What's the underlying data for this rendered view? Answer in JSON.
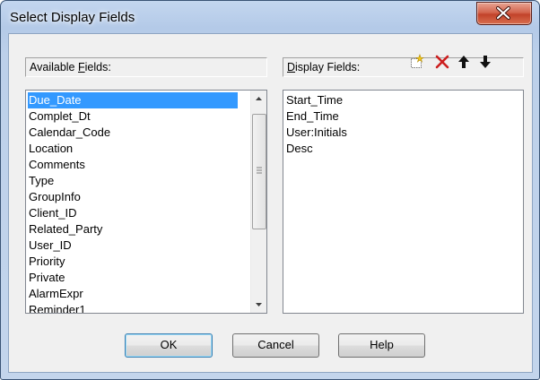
{
  "dialog": {
    "title": "Select Display Fields"
  },
  "available_fields": {
    "label_pre": "Available ",
    "label_key": "F",
    "label_post": "ields:",
    "items": [
      "Due_Date",
      "Complet_Dt",
      "Calendar_Code",
      "Location",
      "Comments",
      "Type",
      "GroupInfo",
      "Client_ID",
      "Related_Party",
      "User_ID",
      "Priority",
      "Private",
      "AlarmExpr",
      "Reminder1"
    ],
    "selected_index": 0
  },
  "display_fields": {
    "label_key": "D",
    "label_post": "isplay Fields:",
    "items": [
      "Start_Time",
      "End_Time",
      "User:Initials",
      "Desc"
    ]
  },
  "toolbar": {
    "icons": [
      "new-icon",
      "delete-icon",
      "move-up-icon",
      "move-down-icon"
    ],
    "delete_color": "#cc1f1f"
  },
  "buttons": {
    "ok": "OK",
    "cancel": "Cancel",
    "help": "Help"
  }
}
